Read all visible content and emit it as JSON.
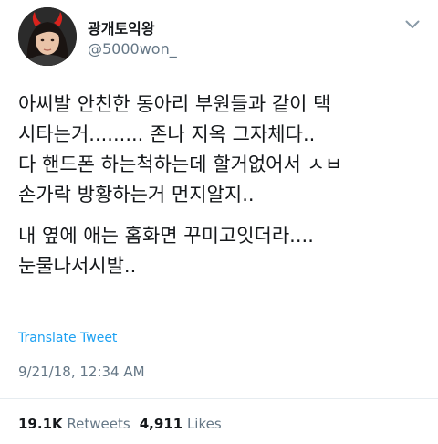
{
  "tweet": {
    "author": {
      "display_name": "광개토익왕",
      "handle": "@5000won_"
    },
    "body": {
      "paragraphs": [
        {
          "lines": [
            "아씨발 안친한 동아리 부원들과 같이 택",
            "시타는거......... 존나 지옥 그자체다..",
            "다 핸드폰 하는척하는데 할거없어서 ㅅㅂ",
            "손가락 방황하는거 먼지알지.."
          ]
        },
        {
          "lines": [
            "내 옆에 애는 홈화면 꾸미고잇더라....",
            "눈물나서시발.."
          ]
        }
      ]
    },
    "translate_label": "Translate Tweet",
    "timestamp": "9/21/18, 12:34 AM",
    "stats": {
      "retweets_count": "19.1K",
      "retweets_label": "Retweets",
      "likes_count": "4,911",
      "likes_label": "Likes"
    }
  },
  "colors": {
    "link": "#1da1f2",
    "secondary_text": "#657786",
    "primary_text": "#14171a",
    "divider": "#e6ecf0"
  },
  "icons": {
    "menu": "chevron-down-icon",
    "avatar_accessory": "devil-horns"
  }
}
